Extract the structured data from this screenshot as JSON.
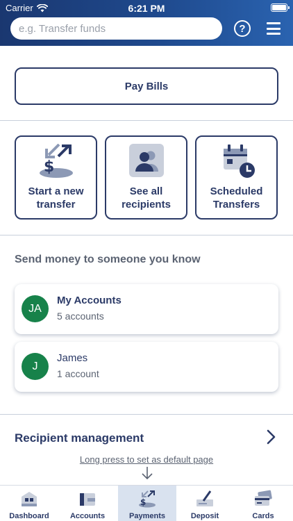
{
  "status_bar": {
    "carrier": "Carrier",
    "time": "6:21 PM"
  },
  "header": {
    "search_placeholder": "e.g. Transfer funds",
    "help_symbol": "?"
  },
  "pay_bills": {
    "label": "Pay Bills"
  },
  "tiles": [
    {
      "icon": "transfer-dollar-icon",
      "label": "Start a new transfer"
    },
    {
      "icon": "recipients-people-icon",
      "label": "See all recipients"
    },
    {
      "icon": "calendar-clock-icon",
      "label": "Scheduled Transfers"
    }
  ],
  "send_section": {
    "title": "Send money to someone you know",
    "recipients": [
      {
        "initials": "JA",
        "name": "My Accounts",
        "detail": "5 accounts"
      },
      {
        "initials": "J",
        "name": "James",
        "detail": "1 account"
      }
    ]
  },
  "recipient_management": {
    "label": "Recipient management"
  },
  "default_hint": "Long press to set as default page",
  "tabbar": {
    "items": [
      {
        "label": "Dashboard",
        "icon": "dashboard-icon"
      },
      {
        "label": "Accounts",
        "icon": "wallet-icon"
      },
      {
        "label": "Payments",
        "icon": "payments-icon"
      },
      {
        "label": "Deposit",
        "icon": "deposit-check-icon"
      },
      {
        "label": "Cards",
        "icon": "cards-icon"
      }
    ],
    "active": "Payments"
  },
  "colors": {
    "navy": "#2b3a67",
    "header_dark": "#1a3770",
    "avatar_green": "#17824a",
    "active_tab": "#d9e2ef"
  }
}
